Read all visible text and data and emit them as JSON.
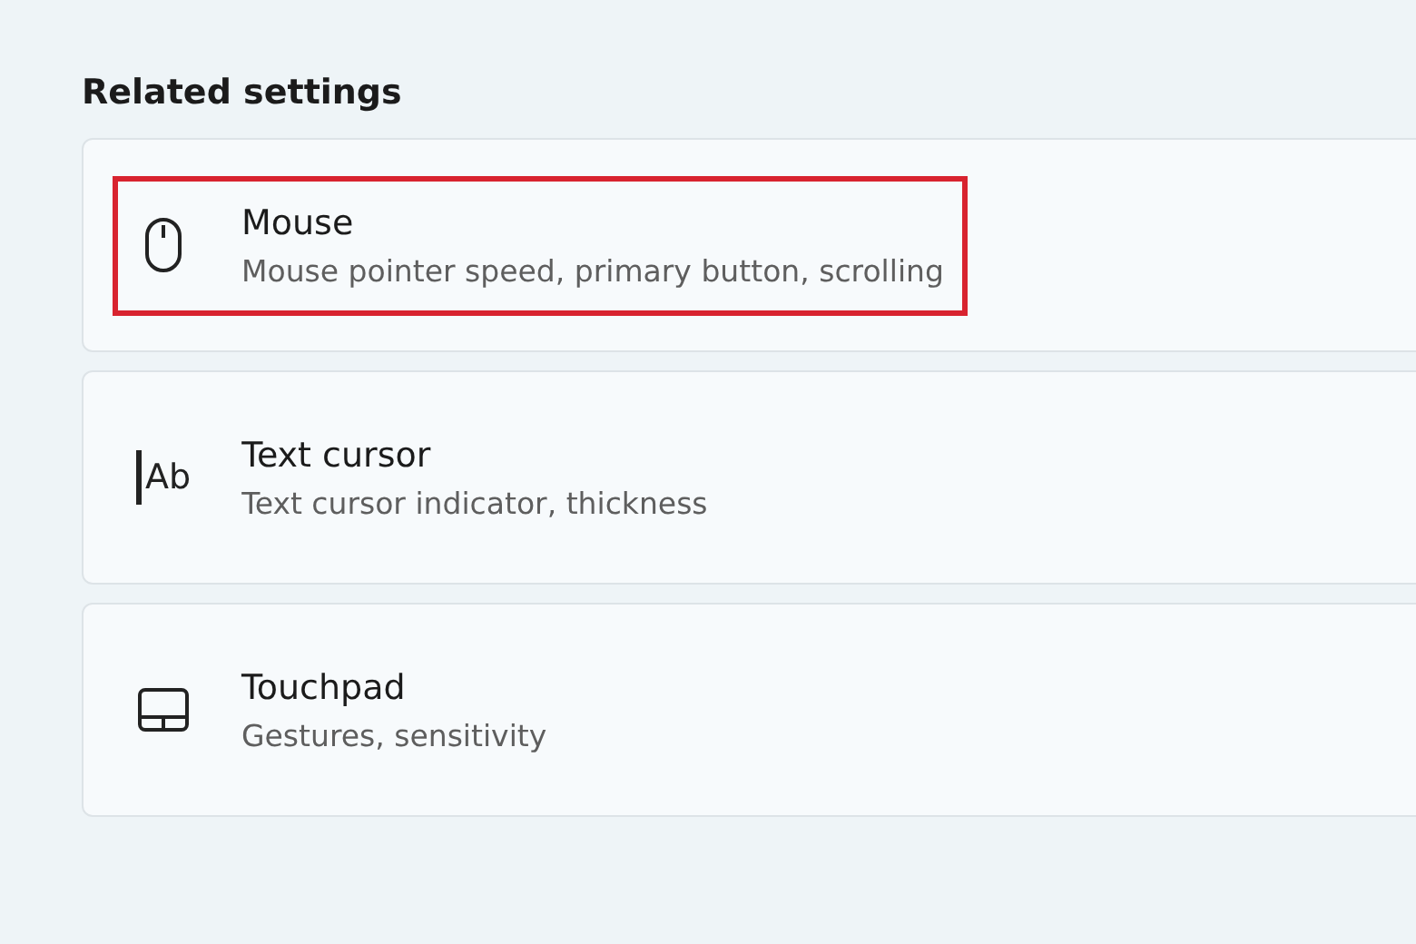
{
  "section": {
    "title": "Related settings"
  },
  "items": [
    {
      "kind": "mouse",
      "title": "Mouse",
      "subtitle": "Mouse pointer speed, primary button, scrolling",
      "highlighted": true
    },
    {
      "kind": "text-cursor",
      "icon_label": "Ab",
      "title": "Text cursor",
      "subtitle": "Text cursor indicator, thickness",
      "highlighted": false
    },
    {
      "kind": "touchpad",
      "title": "Touchpad",
      "subtitle": "Gestures, sensitivity",
      "highlighted": false
    }
  ]
}
